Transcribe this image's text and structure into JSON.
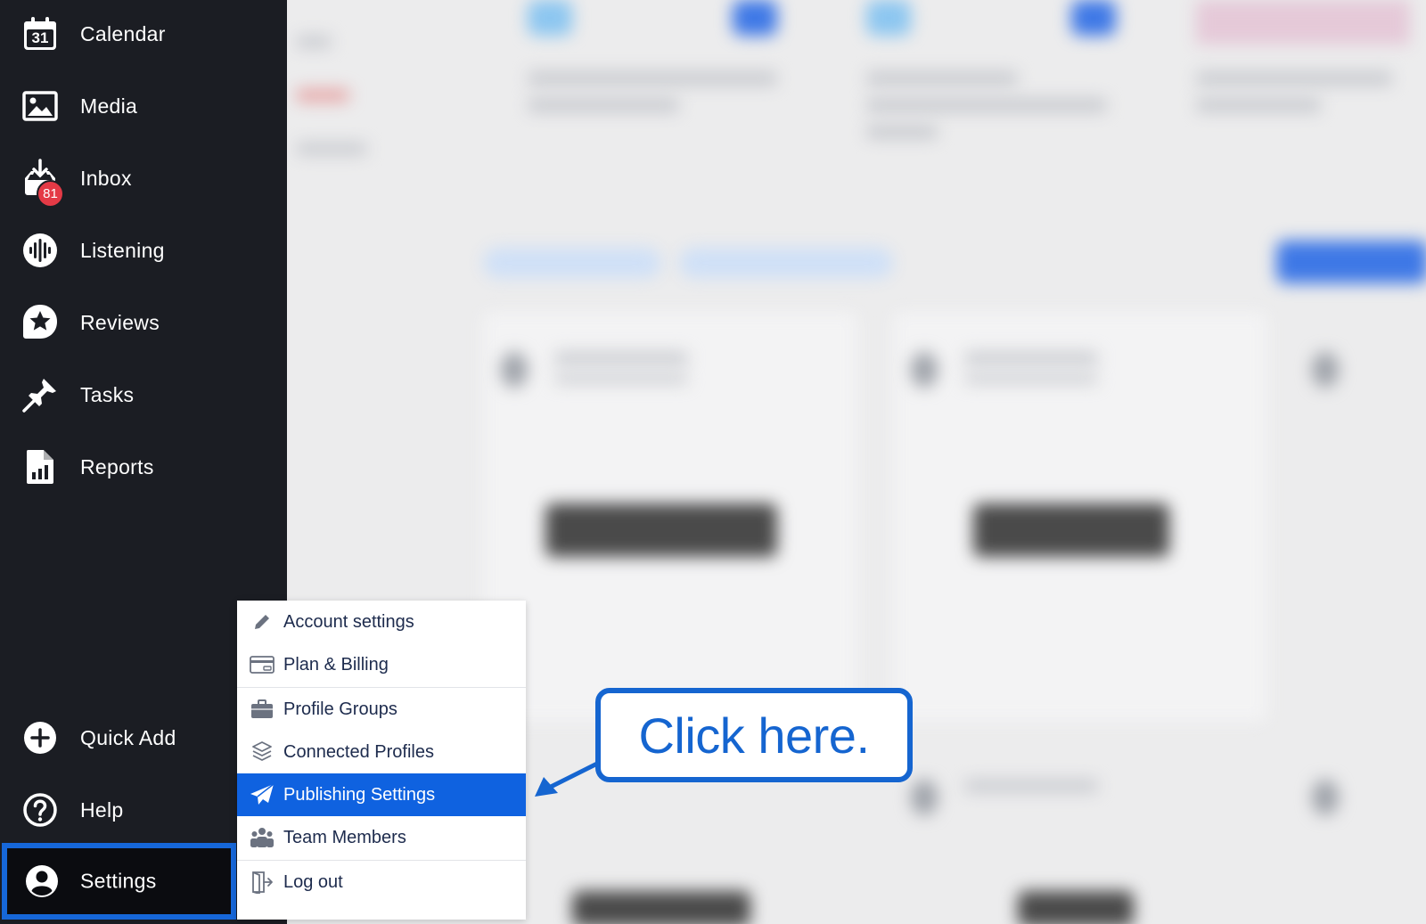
{
  "sidebar": {
    "items": [
      {
        "label": "Calendar",
        "icon": "calendar-icon",
        "icon_text": "31"
      },
      {
        "label": "Media",
        "icon": "image-icon"
      },
      {
        "label": "Inbox",
        "icon": "inbox-icon",
        "badge": "81"
      },
      {
        "label": "Listening",
        "icon": "audio-wave-icon"
      },
      {
        "label": "Reviews",
        "icon": "star-icon"
      },
      {
        "label": "Tasks",
        "icon": "pin-icon"
      },
      {
        "label": "Reports",
        "icon": "report-icon"
      }
    ],
    "bottom_items": [
      {
        "label": "Quick Add",
        "icon": "plus-circle-icon"
      },
      {
        "label": "Help",
        "icon": "help-circle-icon"
      },
      {
        "label": "Settings",
        "icon": "user-circle-icon"
      }
    ]
  },
  "settings_menu": {
    "items": [
      {
        "label": "Account settings",
        "icon": "pencil-icon"
      },
      {
        "label": "Plan & Billing",
        "icon": "credit-card-icon"
      },
      {
        "label": "Profile Groups",
        "icon": "briefcase-icon"
      },
      {
        "label": "Connected Profiles",
        "icon": "layers-icon"
      },
      {
        "label": "Publishing Settings",
        "icon": "paper-plane-icon",
        "active": true
      },
      {
        "label": "Team Members",
        "icon": "team-icon"
      },
      {
        "label": "Log out",
        "icon": "logout-icon"
      }
    ]
  },
  "callout": {
    "text": "Click here."
  },
  "colors": {
    "sidebar_bg": "#1b1d23",
    "accent": "#0f62e0",
    "badge": "#e43a46",
    "callout_border": "#1565d0"
  }
}
